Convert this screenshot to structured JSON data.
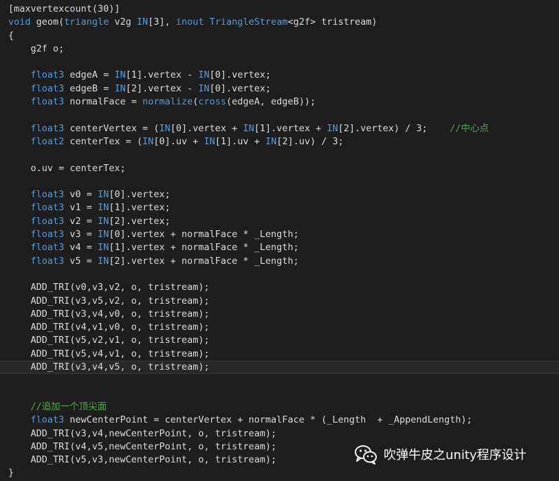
{
  "colors": {
    "background": "#1e1e1e",
    "default_text": "#dcdcdc",
    "keyword": "#569cd6",
    "comment": "#57a64a",
    "current_line": "#282828",
    "watermark_text": "#ffffff"
  },
  "code": {
    "lines": [
      {
        "current": false,
        "segments": [
          {
            "t": "[maxvertexcount(30)]",
            "c": "t"
          }
        ]
      },
      {
        "current": false,
        "segments": [
          {
            "t": "void",
            "c": "k"
          },
          {
            "t": " geom(",
            "c": "t"
          },
          {
            "t": "triangle",
            "c": "k"
          },
          {
            "t": " v2g ",
            "c": "t"
          },
          {
            "t": "IN",
            "c": "k"
          },
          {
            "t": "[3], ",
            "c": "t"
          },
          {
            "t": "inout",
            "c": "k"
          },
          {
            "t": " ",
            "c": "t"
          },
          {
            "t": "TriangleStream",
            "c": "k"
          },
          {
            "t": "<g2f> tristream)",
            "c": "t"
          }
        ]
      },
      {
        "current": false,
        "segments": [
          {
            "t": "{",
            "c": "t"
          }
        ]
      },
      {
        "current": false,
        "segments": [
          {
            "t": "    g2f o;",
            "c": "t"
          }
        ]
      },
      {
        "current": false,
        "segments": []
      },
      {
        "current": false,
        "segments": [
          {
            "t": "    ",
            "c": "t"
          },
          {
            "t": "float3",
            "c": "k"
          },
          {
            "t": " edgeA = ",
            "c": "t"
          },
          {
            "t": "IN",
            "c": "k"
          },
          {
            "t": "[1].vertex - ",
            "c": "t"
          },
          {
            "t": "IN",
            "c": "k"
          },
          {
            "t": "[0].vertex;",
            "c": "t"
          }
        ]
      },
      {
        "current": false,
        "segments": [
          {
            "t": "    ",
            "c": "t"
          },
          {
            "t": "float3",
            "c": "k"
          },
          {
            "t": " edgeB = ",
            "c": "t"
          },
          {
            "t": "IN",
            "c": "k"
          },
          {
            "t": "[2].vertex - ",
            "c": "t"
          },
          {
            "t": "IN",
            "c": "k"
          },
          {
            "t": "[0].vertex;",
            "c": "t"
          }
        ]
      },
      {
        "current": false,
        "segments": [
          {
            "t": "    ",
            "c": "t"
          },
          {
            "t": "float3",
            "c": "k"
          },
          {
            "t": " normalFace = ",
            "c": "t"
          },
          {
            "t": "normalize",
            "c": "k"
          },
          {
            "t": "(",
            "c": "t"
          },
          {
            "t": "cross",
            "c": "k"
          },
          {
            "t": "(edgeA, edgeB));",
            "c": "t"
          }
        ]
      },
      {
        "current": false,
        "segments": []
      },
      {
        "current": false,
        "segments": [
          {
            "t": "    ",
            "c": "t"
          },
          {
            "t": "float3",
            "c": "k"
          },
          {
            "t": " centerVertex = (",
            "c": "t"
          },
          {
            "t": "IN",
            "c": "k"
          },
          {
            "t": "[0].vertex + ",
            "c": "t"
          },
          {
            "t": "IN",
            "c": "k"
          },
          {
            "t": "[1].vertex + ",
            "c": "t"
          },
          {
            "t": "IN",
            "c": "k"
          },
          {
            "t": "[2].vertex) / 3;    ",
            "c": "t"
          },
          {
            "t": "//中心点",
            "c": "c"
          }
        ]
      },
      {
        "current": false,
        "segments": [
          {
            "t": "    ",
            "c": "t"
          },
          {
            "t": "float2",
            "c": "k"
          },
          {
            "t": " centerTex = (",
            "c": "t"
          },
          {
            "t": "IN",
            "c": "k"
          },
          {
            "t": "[0].uv + ",
            "c": "t"
          },
          {
            "t": "IN",
            "c": "k"
          },
          {
            "t": "[1].uv + ",
            "c": "t"
          },
          {
            "t": "IN",
            "c": "k"
          },
          {
            "t": "[2].uv) / 3;",
            "c": "t"
          }
        ]
      },
      {
        "current": false,
        "segments": []
      },
      {
        "current": false,
        "segments": [
          {
            "t": "    o.uv = centerTex;",
            "c": "t"
          }
        ]
      },
      {
        "current": false,
        "segments": []
      },
      {
        "current": false,
        "segments": [
          {
            "t": "    ",
            "c": "t"
          },
          {
            "t": "float3",
            "c": "k"
          },
          {
            "t": " v0 = ",
            "c": "t"
          },
          {
            "t": "IN",
            "c": "k"
          },
          {
            "t": "[0].vertex;",
            "c": "t"
          }
        ]
      },
      {
        "current": false,
        "segments": [
          {
            "t": "    ",
            "c": "t"
          },
          {
            "t": "float3",
            "c": "k"
          },
          {
            "t": " v1 = ",
            "c": "t"
          },
          {
            "t": "IN",
            "c": "k"
          },
          {
            "t": "[1].vertex;",
            "c": "t"
          }
        ]
      },
      {
        "current": false,
        "segments": [
          {
            "t": "    ",
            "c": "t"
          },
          {
            "t": "float3",
            "c": "k"
          },
          {
            "t": " v2 = ",
            "c": "t"
          },
          {
            "t": "IN",
            "c": "k"
          },
          {
            "t": "[2].vertex;",
            "c": "t"
          }
        ]
      },
      {
        "current": false,
        "segments": [
          {
            "t": "    ",
            "c": "t"
          },
          {
            "t": "float3",
            "c": "k"
          },
          {
            "t": " v3 = ",
            "c": "t"
          },
          {
            "t": "IN",
            "c": "k"
          },
          {
            "t": "[0].vertex + normalFace * _Length;",
            "c": "t"
          }
        ]
      },
      {
        "current": false,
        "segments": [
          {
            "t": "    ",
            "c": "t"
          },
          {
            "t": "float3",
            "c": "k"
          },
          {
            "t": " v4 = ",
            "c": "t"
          },
          {
            "t": "IN",
            "c": "k"
          },
          {
            "t": "[1].vertex + normalFace * _Length;",
            "c": "t"
          }
        ]
      },
      {
        "current": false,
        "segments": [
          {
            "t": "    ",
            "c": "t"
          },
          {
            "t": "float3",
            "c": "k"
          },
          {
            "t": " v5 = ",
            "c": "t"
          },
          {
            "t": "IN",
            "c": "k"
          },
          {
            "t": "[2].vertex + normalFace * _Length;",
            "c": "t"
          }
        ]
      },
      {
        "current": false,
        "segments": []
      },
      {
        "current": false,
        "segments": [
          {
            "t": "    ADD_TRI(v0,v3,v2, o, tristream);",
            "c": "t"
          }
        ]
      },
      {
        "current": false,
        "segments": [
          {
            "t": "    ADD_TRI(v3,v5,v2, o, tristream);",
            "c": "t"
          }
        ]
      },
      {
        "current": false,
        "segments": [
          {
            "t": "    ADD_TRI(v3,v4,v0, o, tristream);",
            "c": "t"
          }
        ]
      },
      {
        "current": false,
        "segments": [
          {
            "t": "    ADD_TRI(v4,v1,v0, o, tristream);",
            "c": "t"
          }
        ]
      },
      {
        "current": false,
        "segments": [
          {
            "t": "    ADD_TRI(v5,v2,v1, o, tristream);",
            "c": "t"
          }
        ]
      },
      {
        "current": false,
        "segments": [
          {
            "t": "    ADD_TRI(v5,v4,v1, o, tristream);",
            "c": "t"
          }
        ]
      },
      {
        "current": true,
        "segments": [
          {
            "t": "    ADD_TRI(v3,v4,v5, o, tristream);",
            "c": "t"
          }
        ]
      },
      {
        "current": false,
        "segments": []
      },
      {
        "current": false,
        "segments": []
      },
      {
        "current": false,
        "segments": [
          {
            "t": "    ",
            "c": "t"
          },
          {
            "t": "//追加一个顶尖面",
            "c": "c"
          }
        ]
      },
      {
        "current": false,
        "segments": [
          {
            "t": "    ",
            "c": "t"
          },
          {
            "t": "float3",
            "c": "k"
          },
          {
            "t": " newCenterPoint = centerVertex + normalFace * (_Length  + _AppendLength);",
            "c": "t"
          }
        ]
      },
      {
        "current": false,
        "segments": [
          {
            "t": "    ADD_TRI(v3,v4,newCenterPoint, o, tristream);",
            "c": "t"
          }
        ]
      },
      {
        "current": false,
        "segments": [
          {
            "t": "    ADD_TRI(v4,v5,newCenterPoint, o, tristream);",
            "c": "t"
          }
        ]
      },
      {
        "current": false,
        "segments": [
          {
            "t": "    ADD_TRI(v5,v3,newCenterPoint, o, tristream);",
            "c": "t"
          }
        ]
      },
      {
        "current": false,
        "segments": [
          {
            "t": "}",
            "c": "t"
          }
        ]
      }
    ]
  },
  "watermark": {
    "icon": "wechat-icon",
    "text": "吹弹牛皮之unity程序设计"
  }
}
